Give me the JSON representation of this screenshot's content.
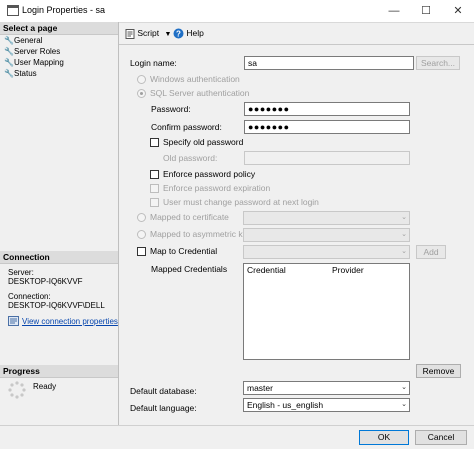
{
  "window": {
    "title": "Login Properties - sa",
    "minimize": "—",
    "maximize": "☐",
    "close": "✕"
  },
  "left_pane": {
    "select_page_header": "Select a page",
    "pages": [
      {
        "label": "General"
      },
      {
        "label": "Server Roles"
      },
      {
        "label": "User Mapping"
      },
      {
        "label": "Status"
      }
    ],
    "connection_header": "Connection",
    "server_label": "Server:",
    "server_value": "DESKTOP-IQ6KVVF",
    "connection_label": "Connection:",
    "connection_value": "DESKTOP-IQ6KVVF\\DELL",
    "view_connection_link": "View connection properties",
    "progress_header": "Progress",
    "progress_status": "Ready"
  },
  "toolbar": {
    "script_label": "Script",
    "help_label": "Help"
  },
  "form": {
    "login_name_label": "Login name:",
    "login_name_value": "sa",
    "search_button": "Search...",
    "windows_auth_label": "Windows authentication",
    "sql_auth_label": "SQL Server authentication",
    "password_label": "Password:",
    "password_value": "●●●●●●●",
    "confirm_password_label": "Confirm password:",
    "confirm_password_value": "●●●●●●●",
    "specify_old_password_label": "Specify old password",
    "old_password_label": "Old password:",
    "old_password_value": "",
    "enforce_policy_label": "Enforce password policy",
    "enforce_expiration_label": "Enforce password expiration",
    "must_change_label": "User must change password at next login",
    "mapped_cert_label": "Mapped to certificate",
    "mapped_asym_label": "Mapped to asymmetric key",
    "map_credential_label": "Map to Credential",
    "add_button": "Add",
    "mapped_credentials_label": "Mapped Credentials",
    "grid_columns": [
      "Credential",
      "Provider"
    ],
    "remove_button": "Remove",
    "default_database_label": "Default database:",
    "default_database_value": "master",
    "default_language_label": "Default language:",
    "default_language_value": "English - us_english"
  },
  "buttons": {
    "ok": "OK",
    "cancel": "Cancel"
  }
}
